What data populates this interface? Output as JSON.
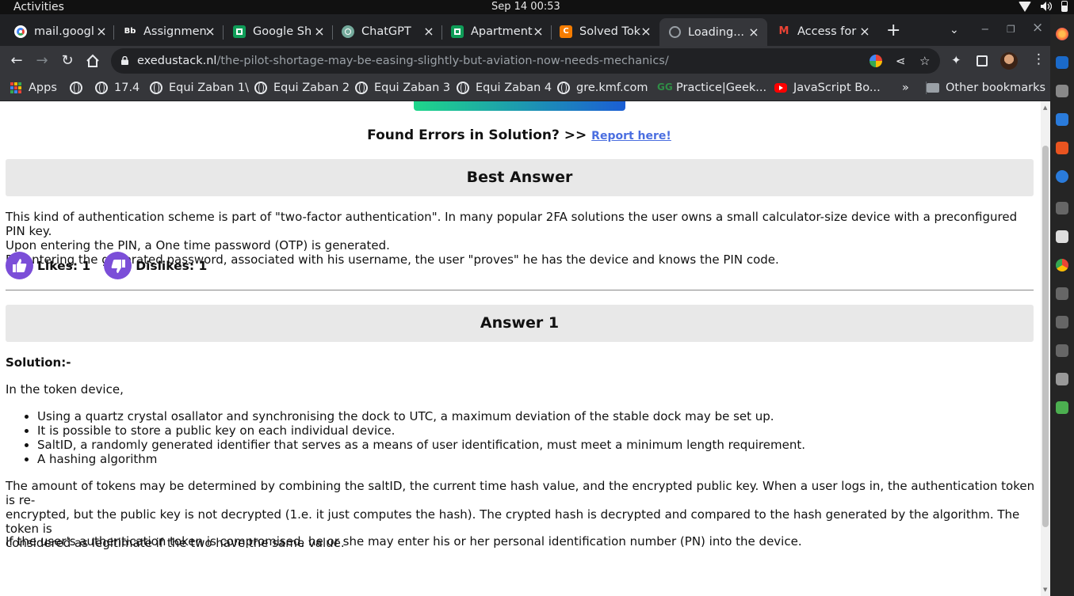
{
  "os": {
    "activities": "Activities",
    "clock": "Sep 14  00:53"
  },
  "tabs": [
    {
      "title": "mail.googl",
      "favicon_color": "#ffffff",
      "favicon_text": ""
    },
    {
      "title": "Assignmen",
      "favicon_color": "#202124",
      "favicon_text": "Bb"
    },
    {
      "title": "Google Sh",
      "favicon_color": "#0f9d58",
      "favicon_text": ""
    },
    {
      "title": "ChatGPT",
      "favicon_color": "#74aa9c",
      "favicon_text": ""
    },
    {
      "title": "Apartment",
      "favicon_color": "#0f9d58",
      "favicon_text": ""
    },
    {
      "title": "Solved Tok",
      "favicon_color": "#f57c00",
      "favicon_text": "C"
    },
    {
      "title": "Loading...",
      "favicon_color": "#9aa0a6",
      "favicon_text": ""
    },
    {
      "title": "Access for",
      "favicon_color": "#ffffff",
      "favicon_text": "M"
    }
  ],
  "toolbar": {
    "url_host": "exedustack.nl",
    "url_path": "/the-pilot-shortage-may-be-easing-slightly-but-aviation-now-needs-mechanics/"
  },
  "bookmarks": {
    "apps": "Apps",
    "items": [
      "",
      "17.4",
      "Equi Zaban 1\\",
      "Equi Zaban 2",
      "Equi Zaban 3",
      "Equi Zaban 4",
      "gre.kmf.com",
      "Practice|Geek...",
      "JavaScript Bo..."
    ],
    "overflow": "»",
    "other": "Other bookmarks"
  },
  "page": {
    "report_text": "Found Errors in Solution? >> ",
    "report_link": "Report here!",
    "best_answer_heading": "Best Answer",
    "best_answer_lines": [
      "This kind of authentication scheme is part of \"two-factor authentication\". In many popular 2FA solutions the user owns a small calculator-size device with a preconfigured PIN key.",
      "Upon entering the PIN, a One time password (OTP) is generated.",
      "By entering the generated password, associated with his username, the user \"proves\" he has the device and knows the PIN code."
    ],
    "likes": "Likes: 1",
    "dislikes": "Dislikes: 1",
    "answer1_heading": "Answer 1",
    "solution_label": "Solution:-",
    "intro": "In the token device,",
    "bullets": [
      "Using a quartz crystal osallator and synchronising the dock to UTC, a maximum deviation of the stable dock may be set up.",
      "It is possible to store a public key on each individual device.",
      "SaltID, a randomly generated identifier that serves as a means of user identification, must meet a minimum length requirement.",
      "A hashing algorithm"
    ],
    "para2_lines": [
      "The amount of tokens may be determined by combining the saltID, the current time hash value, and the encrypted public key. When a user logs in, the authentication token is re-",
      "encrypted, but the public key is not decrypted (1.e. it just computes the hash). The crypted hash is decrypted and compared to the hash generated by the algorithm. The token is",
      "considered as legitimate if the two have the same value."
    ],
    "para3": "If the user's authentication token is compromised, he or she may enter his or her personal identification number (PN) into the device."
  },
  "colors": {
    "accent_purple": "#7b4ed8",
    "link_blue": "#4a6ee0",
    "section_bg": "#e8e8e8"
  }
}
